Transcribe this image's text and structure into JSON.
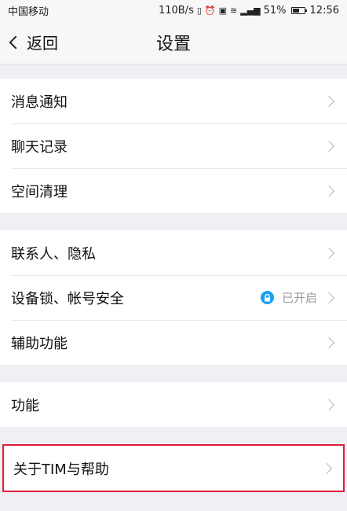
{
  "status_bar": {
    "carrier": "中国移动",
    "net_speed": "110B/s",
    "battery": "51%",
    "time": "12:56"
  },
  "nav": {
    "back_label": "返回",
    "title": "设置"
  },
  "groups": [
    {
      "items": [
        {
          "label": "消息通知"
        },
        {
          "label": "聊天记录"
        },
        {
          "label": "空间清理"
        }
      ]
    },
    {
      "items": [
        {
          "label": "联系人、隐私"
        },
        {
          "label": "设备锁、帐号安全",
          "status": "已开启"
        },
        {
          "label": "辅助功能"
        }
      ]
    },
    {
      "items": [
        {
          "label": "功能"
        }
      ]
    },
    {
      "items": [
        {
          "label": "关于TIM与帮助"
        }
      ]
    }
  ],
  "colors": {
    "highlight_outline": "#e01c3c",
    "lock_badge": "#1aa0f2"
  }
}
